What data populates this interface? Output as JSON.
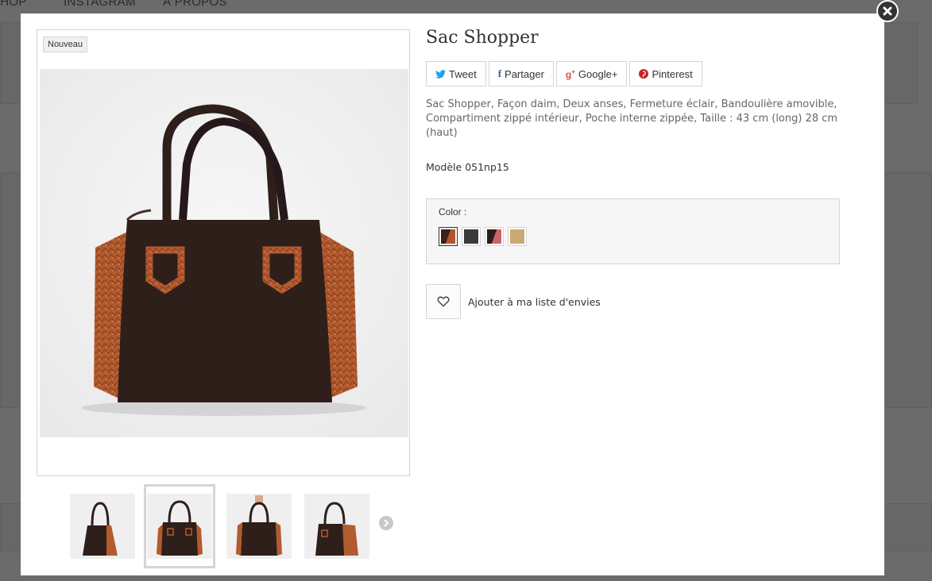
{
  "background_nav": [
    "SHOP",
    "INSTAGRAM",
    "À PROPOS"
  ],
  "modal": {
    "badge": "Nouveau",
    "product_title": "Sac Shopper",
    "share": {
      "tweet": "Tweet",
      "facebook": "Partager",
      "google": "Google+",
      "pinterest": "Pinterest"
    },
    "description": "Sac Shopper, Façon daim, Deux anses, Fermeture éclair, Bandoulière amovible, Compartiment zippé intérieur, Poche interne zippée, Taille : 43 cm (long) 28 cm (haut)",
    "model": "Modèle 051np15",
    "color": {
      "label": "Color :",
      "options": [
        {
          "name": "brown-orange",
          "colors": [
            "#3a2218",
            "#b3562b"
          ]
        },
        {
          "name": "black",
          "colors": [
            "#3a3a3a",
            "#3a3a3a"
          ]
        },
        {
          "name": "black-pink",
          "colors": [
            "#2b1d1b",
            "#c8646b"
          ]
        },
        {
          "name": "beige",
          "colors": [
            "#caa973",
            "#caa973"
          ]
        }
      ],
      "selected": 0
    },
    "wishlist_label": "Ajouter à ma liste d'envies"
  },
  "colors": {
    "bag_body": "#2e1f1b",
    "bag_side": "#b35a2e",
    "twitter": "#1da1f2",
    "facebook": "#3b5998",
    "google": "#dd4b39",
    "pinterest": "#cb2027"
  }
}
